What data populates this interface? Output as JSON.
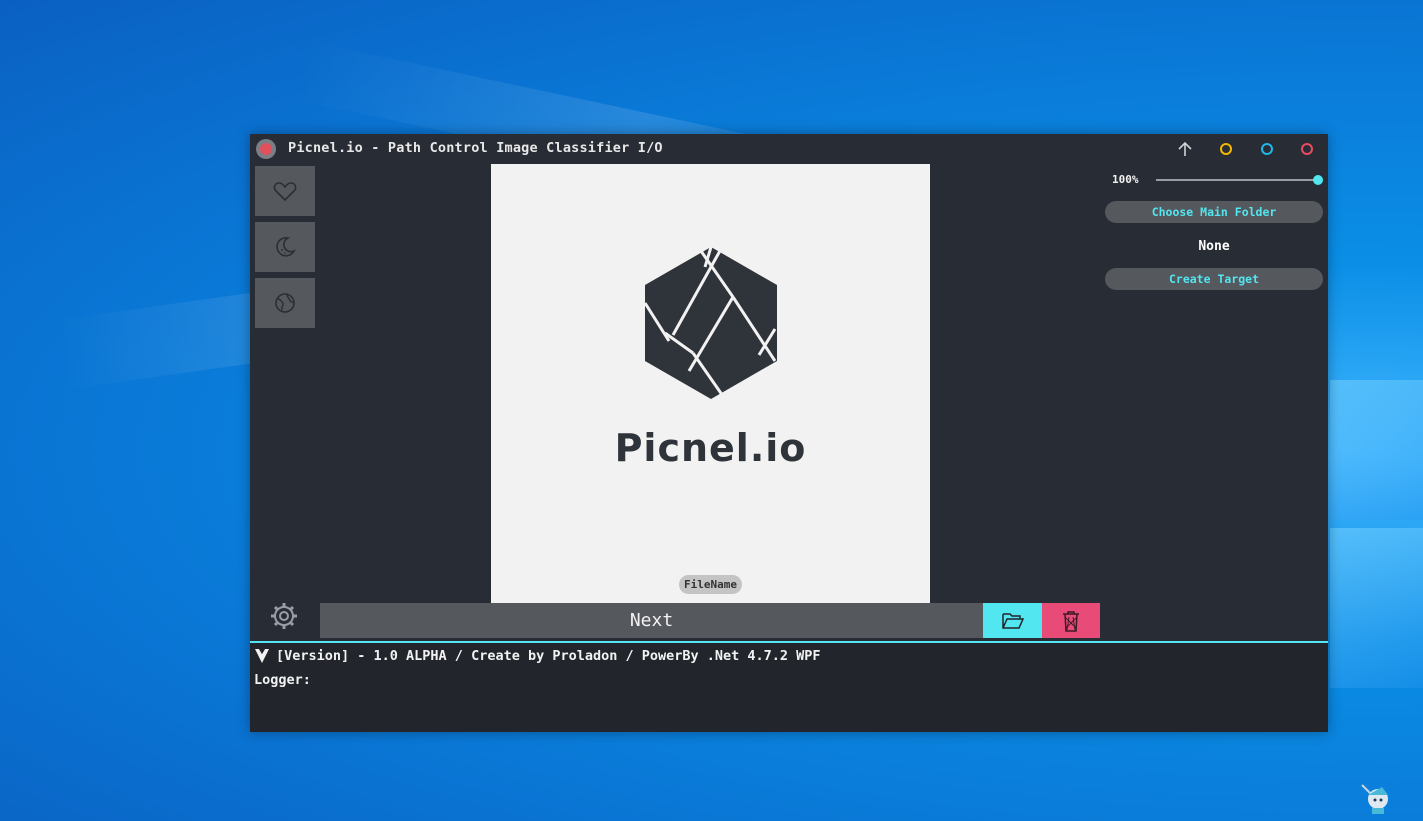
{
  "window": {
    "title": "Picnel.io - Path Control Image Classifier I/O",
    "controls": [
      "arrow-up-icon",
      "minimize-circle",
      "maximize-circle",
      "close-circle"
    ],
    "control_colors": {
      "minimize": "#f2b705",
      "maximize": "#20b8e8",
      "close": "#e94b5f"
    }
  },
  "sidebar": {
    "items": [
      {
        "icon": "heart-icon"
      },
      {
        "icon": "moon-icon"
      },
      {
        "icon": "globe-icon"
      }
    ]
  },
  "viewer": {
    "logo_text": "Picnel.io",
    "filename": "FileName"
  },
  "controls": {
    "next_label": "Next",
    "open_folder_icon": "folder-open-icon",
    "delete_icon": "trash-icon"
  },
  "right_panel": {
    "zoom": "100%",
    "zoom_value": 1.0,
    "choose_folder_label": "Choose Main Folder",
    "folder_value": "None",
    "create_target_label": "Create Target"
  },
  "log": {
    "version_line": "[Version] - 1.0 ALPHA / Create by Proladon / PowerBy .Net 4.7.2 WPF",
    "logger_label": "Logger:"
  },
  "colors": {
    "accent_cyan": "#52e6f0",
    "accent_pink": "#e94b79",
    "window_bg": "#282c34",
    "button_bg": "#55585d"
  }
}
